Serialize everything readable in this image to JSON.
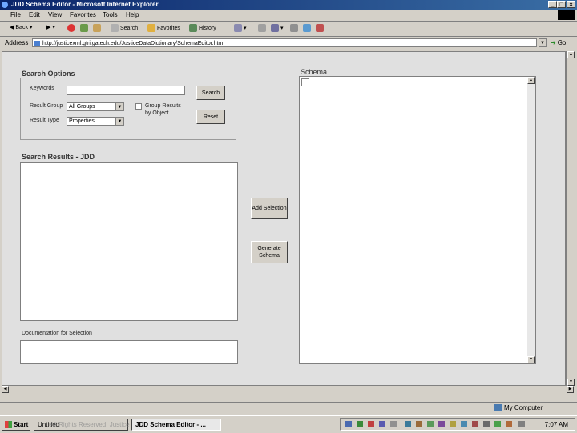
{
  "window": {
    "title": "JDD Schema Editor - Microsoft Internet Explorer",
    "min": "_",
    "max": "□",
    "close": "×"
  },
  "menu": [
    "File",
    "Edit",
    "View",
    "Favorites",
    "Tools",
    "Help"
  ],
  "toolbar": {
    "back": "Back",
    "search": "Search",
    "favorites": "Favorites",
    "history": "History"
  },
  "address": {
    "label": "Address",
    "url": "http://justicexml.gtri.gatech.edu/JusticeDataDictionary/SchemaEditor.htm",
    "go": "Go"
  },
  "search_options": {
    "title": "Search Options",
    "keywords_label": "Keywords",
    "keywords_value": "",
    "search_button": "Search",
    "result_group_label": "Result Group",
    "result_group_value": "All Groups",
    "result_type_label": "Result Type",
    "result_type_value": "Properties",
    "group_results_label": "Group Results by Object",
    "reset_button": "Reset"
  },
  "search_results": {
    "title": "Search Results - JDD"
  },
  "actions": {
    "add_selection": "Add Selection",
    "generate_schema": "Generate Schema"
  },
  "documentation": {
    "label": "Documentation for Selection"
  },
  "schema": {
    "title": "Schema"
  },
  "status": {
    "zone": "My Computer"
  },
  "taskbar": {
    "start": "Start",
    "task1": "Untitled",
    "task2": "JDD Schema Editor - ...",
    "watermark": "All Rights Reserved: Justice Object",
    "clock": "7:07 AM"
  },
  "colors": {
    "title_bar": "#0a246a",
    "chrome": "#d4d0c8",
    "content_bg": "#e0e0e0"
  }
}
